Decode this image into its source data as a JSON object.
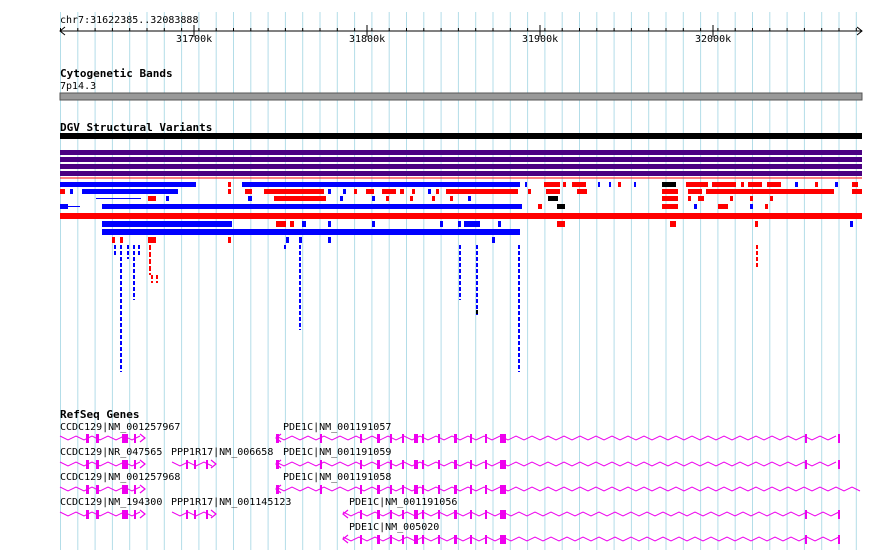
{
  "ruler": {
    "location": "chr7:31622385..32083888",
    "ticks": [
      "31700k",
      "31800k",
      "31900k",
      "32000k"
    ]
  },
  "tracks": {
    "cytoband": {
      "title": "Cytogenetic Bands",
      "band": "7p14.3"
    },
    "dgv": {
      "title": "DGV Structural Variants"
    },
    "refseq": {
      "title": "RefSeq Genes",
      "genes": [
        "CCDC129|NM_001257967",
        "PDE1C|NM_001191057",
        "CCDC129|NR_047565",
        "PPP1R17|NM_006658",
        "PDE1C|NM_001191059",
        "CCDC129|NM_001257968",
        "PDE1C|NM_001191058",
        "CCDC129|NM_194300",
        "PPP1R17|NM_001145123",
        "PDE1C|NM_001191056",
        "PDE1C|NM_005020"
      ]
    }
  },
  "colors": {
    "grid": "#b3dde8",
    "loss": "#ff0000",
    "gain": "#0000ff",
    "inversion": "#000000",
    "complex": "#4b0082",
    "gene": "#ee00ee",
    "cytoband": "#999999"
  }
}
